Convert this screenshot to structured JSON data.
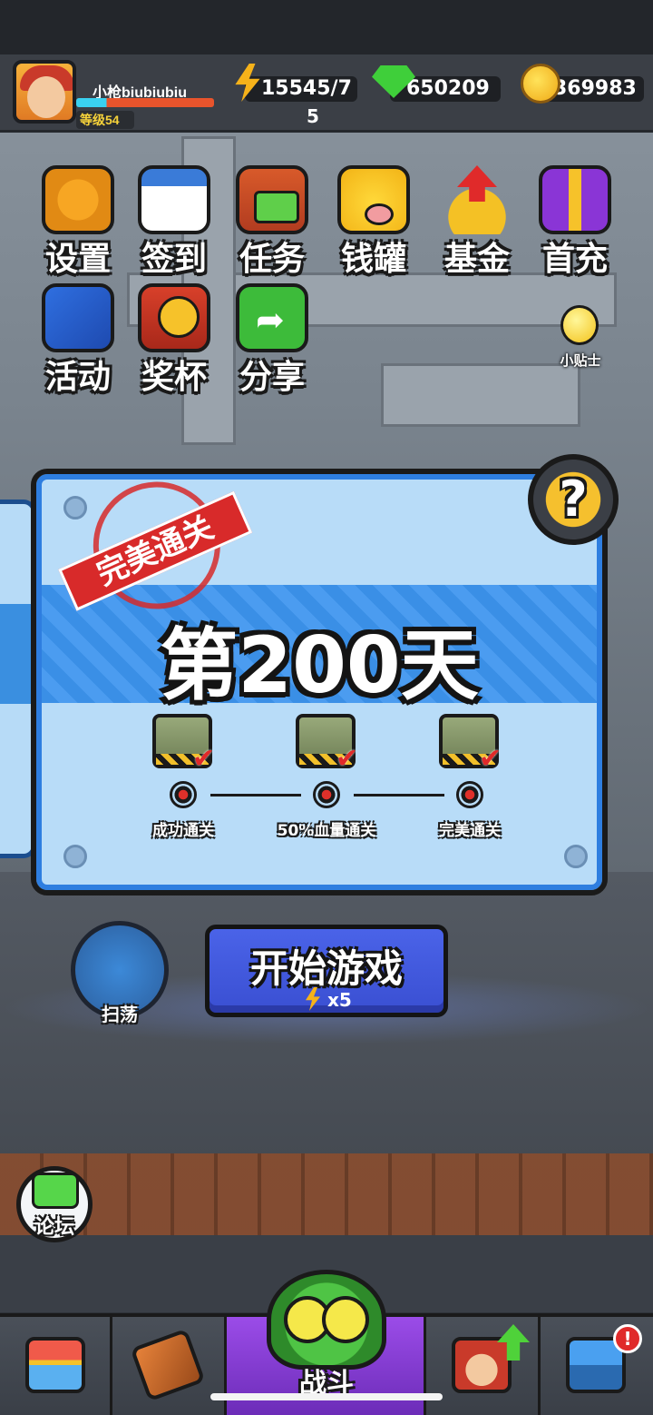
{
  "player": {
    "name": "小枪biubiubiu",
    "level_label": "等级54",
    "xp_progress": 0.22
  },
  "resources": {
    "energy_line1": "15545/7",
    "energy_line2": "5",
    "gems": "650209",
    "coins": "369983"
  },
  "menu": {
    "settings": "设置",
    "checkin": "签到",
    "tasks": "任务",
    "piggy_bank": "钱罐",
    "fund": "基金",
    "first_recharge": "首充",
    "events": "活动",
    "trophy": "奖杯",
    "share": "分享"
  },
  "tips_label": "小贴士",
  "level_card": {
    "title": "第200天",
    "stamp": "完美通关",
    "help_symbol": "?",
    "goals": [
      {
        "label": "成功通关",
        "completed": true
      },
      {
        "label": "50%血量通关",
        "completed": true
      },
      {
        "label": "完美通关",
        "completed": true
      }
    ]
  },
  "sweep_label": "扫荡",
  "start_button": {
    "label": "开始游戏",
    "cost": "x5"
  },
  "forum_label": "论坛",
  "bottom_nav": {
    "battle_label": "战斗",
    "alert_badge": "!"
  }
}
